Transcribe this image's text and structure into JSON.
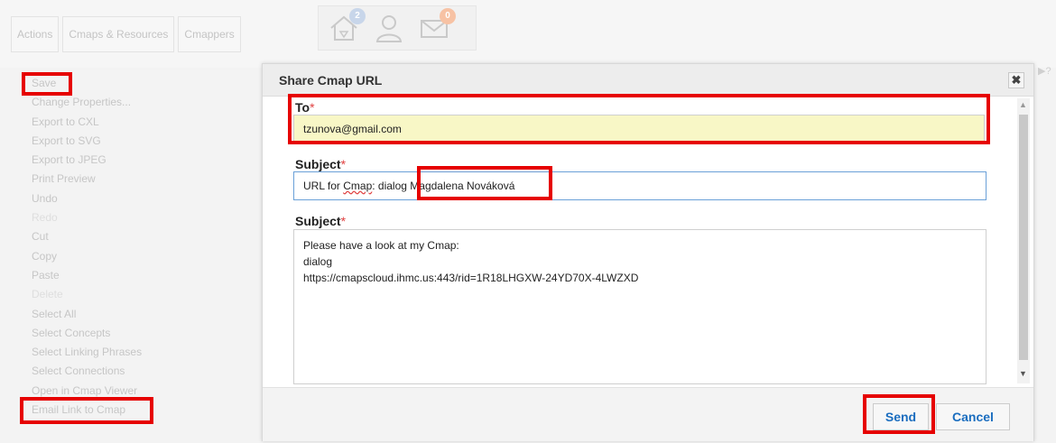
{
  "topbar": {
    "tabs": [
      "Actions",
      "Cmaps & Resources",
      "Cmappers"
    ],
    "icons": [
      {
        "name": "home-icon",
        "badge": "2",
        "badge_color": "#c8d6ea"
      },
      {
        "name": "user-icon",
        "badge": null
      },
      {
        "name": "mail-icon",
        "badge": "0",
        "badge_color": "#f7c2a4"
      }
    ]
  },
  "menu": {
    "items": [
      {
        "label": "Save",
        "faint": false
      },
      {
        "label": "Change Properties...",
        "faint": false
      },
      {
        "label": "Export to CXL",
        "faint": false
      },
      {
        "label": "Export to SVG",
        "faint": false
      },
      {
        "label": "Export to JPEG",
        "faint": false
      },
      {
        "label": "Print Preview",
        "faint": false
      },
      {
        "label": "Undo",
        "faint": false
      },
      {
        "label": "Redo",
        "faint": true
      },
      {
        "label": "Cut",
        "faint": false
      },
      {
        "label": "Copy",
        "faint": false
      },
      {
        "label": "Paste",
        "faint": false
      },
      {
        "label": "Delete",
        "faint": true
      },
      {
        "label": "Select All",
        "faint": false
      },
      {
        "label": "Select Concepts",
        "faint": false
      },
      {
        "label": "Select Linking Phrases",
        "faint": false
      },
      {
        "label": "Select Connections",
        "faint": false
      },
      {
        "label": "Open in Cmap Viewer",
        "faint": false
      },
      {
        "label": "Email Link to Cmap",
        "faint": false
      }
    ]
  },
  "dialog": {
    "title": "Share Cmap URL",
    "close_glyph": "✖",
    "to": {
      "label": "To",
      "required": "*",
      "value": "tzunova@gmail.com"
    },
    "subject": {
      "label": "Subject",
      "required": "*",
      "prefix": "URL for ",
      "squiggle_word": "Cmap",
      "rest": ": dialog",
      "name": " Magdalena Nováková"
    },
    "body": {
      "label": "Subject",
      "required": "*",
      "lines": [
        "Please have a look at my Cmap:",
        "dialog",
        "https://cmapscloud.ihmc.us:443/rid=1R18LHGXW-24YD70X-4LWZXD"
      ]
    },
    "send_label": "Send",
    "cancel_label": "Cancel"
  },
  "colors": {
    "highlight": "#e60000",
    "accent": "#1a6dbf",
    "to_field_bg": "#f8f7c6"
  }
}
